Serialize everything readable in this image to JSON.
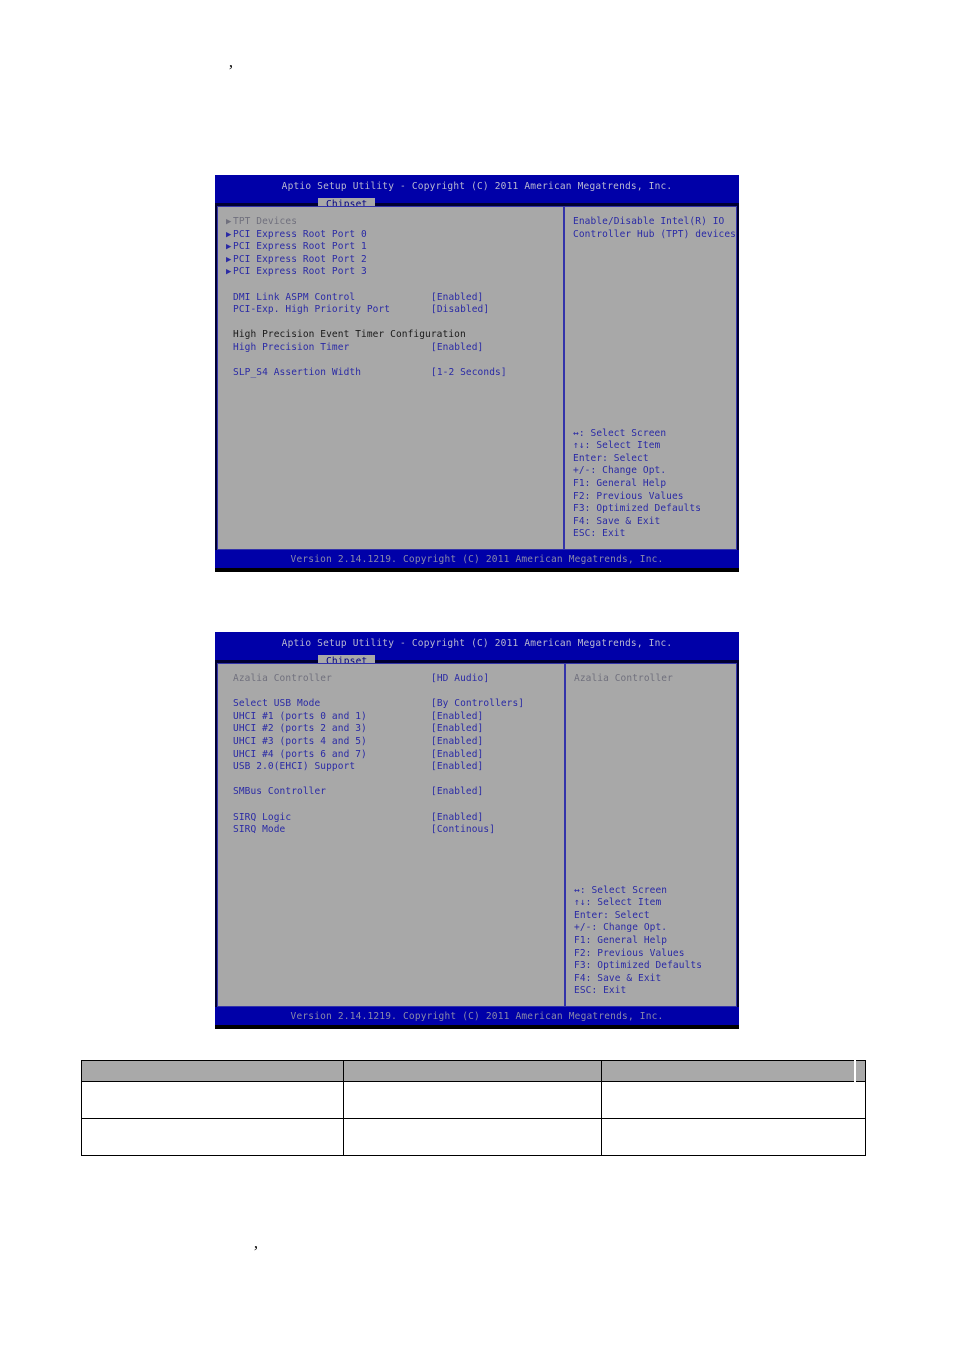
{
  "artifacts": {
    "top_mark": "’",
    "bottom_mark": "’"
  },
  "bios_screens": [
    {
      "id": "chipset-pch-io-configuration",
      "title": "Aptio Setup Utility - Copyright (C) 2011 American Megatrends, Inc.",
      "tab": "Chipset",
      "footer": "Version 2.14.1219. Copyright (C) 2011 American Megatrends, Inc.",
      "options": [
        {
          "kind": "submenu",
          "bullet": "▶",
          "label": "TPT Devices",
          "value": "",
          "selected": true
        },
        {
          "kind": "submenu",
          "bullet": "▶",
          "label": "PCI Express Root Port 0",
          "value": "",
          "selected": false
        },
        {
          "kind": "submenu",
          "bullet": "▶",
          "label": "PCI Express Root Port 1",
          "value": "",
          "selected": false
        },
        {
          "kind": "submenu",
          "bullet": "▶",
          "label": "PCI Express Root Port 2",
          "value": "",
          "selected": false
        },
        {
          "kind": "submenu",
          "bullet": "▶",
          "label": "PCI Express Root Port 3",
          "value": "",
          "selected": false
        },
        {
          "kind": "spacer",
          "bullet": "",
          "label": "",
          "value": "",
          "selected": false
        },
        {
          "kind": "setting",
          "bullet": "",
          "label": "DMI Link ASPM Control",
          "value": "[Enabled]",
          "selected": false
        },
        {
          "kind": "setting",
          "bullet": "",
          "label": "PCI-Exp. High Priority Port",
          "value": "[Disabled]",
          "selected": false
        },
        {
          "kind": "spacer",
          "bullet": "",
          "label": "",
          "value": "",
          "selected": false
        },
        {
          "kind": "heading",
          "bullet": "",
          "label": "High Precision Event Timer Configuration",
          "value": "",
          "selected": false
        },
        {
          "kind": "setting",
          "bullet": "",
          "label": "High Precision Timer",
          "value": "[Enabled]",
          "selected": false
        },
        {
          "kind": "spacer",
          "bullet": "",
          "label": "",
          "value": "",
          "selected": false
        },
        {
          "kind": "setting",
          "bullet": "",
          "label": "SLP_S4 Assertion Width",
          "value": "[1-2 Seconds]",
          "selected": false
        }
      ],
      "help_lines": [
        "Enable/Disable Intel(R) IO",
        "Controller Hub (TPT) devices"
      ],
      "help_selected": false,
      "navkeys": [
        "↔: Select Screen",
        "↑↓: Select Item",
        "Enter: Select",
        "+/-: Change Opt.",
        "F1: General Help",
        "F2: Previous Values",
        "F3: Optimized Defaults",
        "F4: Save & Exit",
        "ESC: Exit"
      ]
    },
    {
      "id": "chipset-azalia-usb-configuration",
      "title": "Aptio Setup Utility - Copyright (C) 2011 American Megatrends, Inc.",
      "tab": "Chipset",
      "footer": "Version 2.14.1219. Copyright (C) 2011 American Megatrends, Inc.",
      "options": [
        {
          "kind": "setting",
          "bullet": "",
          "label": "Azalia Controller",
          "value": "[HD Audio]",
          "selected": true
        },
        {
          "kind": "spacer",
          "bullet": "",
          "label": "",
          "value": "",
          "selected": false
        },
        {
          "kind": "setting",
          "bullet": "",
          "label": "Select USB Mode",
          "value": "[By Controllers]",
          "selected": false
        },
        {
          "kind": "setting",
          "bullet": "",
          "label": "UHCI #1 (ports 0 and 1)",
          "value": "[Enabled]",
          "selected": false
        },
        {
          "kind": "setting",
          "bullet": "",
          "label": "UHCI #2 (ports 2 and 3)",
          "value": "[Enabled]",
          "selected": false
        },
        {
          "kind": "setting",
          "bullet": "",
          "label": "UHCI #3 (ports 4 and 5)",
          "value": "[Enabled]",
          "selected": false
        },
        {
          "kind": "setting",
          "bullet": "",
          "label": "UHCI #4 (ports 6 and 7)",
          "value": "[Enabled]",
          "selected": false
        },
        {
          "kind": "setting",
          "bullet": "",
          "label": "USB 2.0(EHCI) Support",
          "value": "[Enabled]",
          "selected": false
        },
        {
          "kind": "spacer",
          "bullet": "",
          "label": "",
          "value": "",
          "selected": false
        },
        {
          "kind": "setting",
          "bullet": "",
          "label": "SMBus Controller",
          "value": "[Enabled]",
          "selected": false
        },
        {
          "kind": "spacer",
          "bullet": "",
          "label": "",
          "value": "",
          "selected": false
        },
        {
          "kind": "setting",
          "bullet": "",
          "label": "SIRQ Logic",
          "value": "[Enabled]",
          "selected": false
        },
        {
          "kind": "setting",
          "bullet": "",
          "label": "SIRQ Mode",
          "value": "[Continous]",
          "selected": false
        }
      ],
      "help_lines": [
        "Azalia Controller"
      ],
      "help_selected": true,
      "navkeys": [
        "↔: Select Screen",
        "↑↓: Select Item",
        "Enter: Select",
        "+/-: Change Opt.",
        "F1: General Help",
        "F2: Previous Values",
        "F3: Optimized Defaults",
        "F4: Save & Exit",
        "ESC: Exit"
      ]
    }
  ],
  "table": {
    "headers": [
      "",
      "",
      "",
      ""
    ],
    "rows": [
      [
        "",
        "",
        "",
        ""
      ],
      [
        "",
        "",
        "",
        ""
      ]
    ]
  },
  "colors": {
    "bios_titlebar": "#0000a8",
    "bios_panel": "#a8a8a8",
    "bios_text": "#2a2aa5",
    "bios_selected_text": "#70707d",
    "table_header": "#a9a9a9",
    "page_background": "#ffffff"
  }
}
